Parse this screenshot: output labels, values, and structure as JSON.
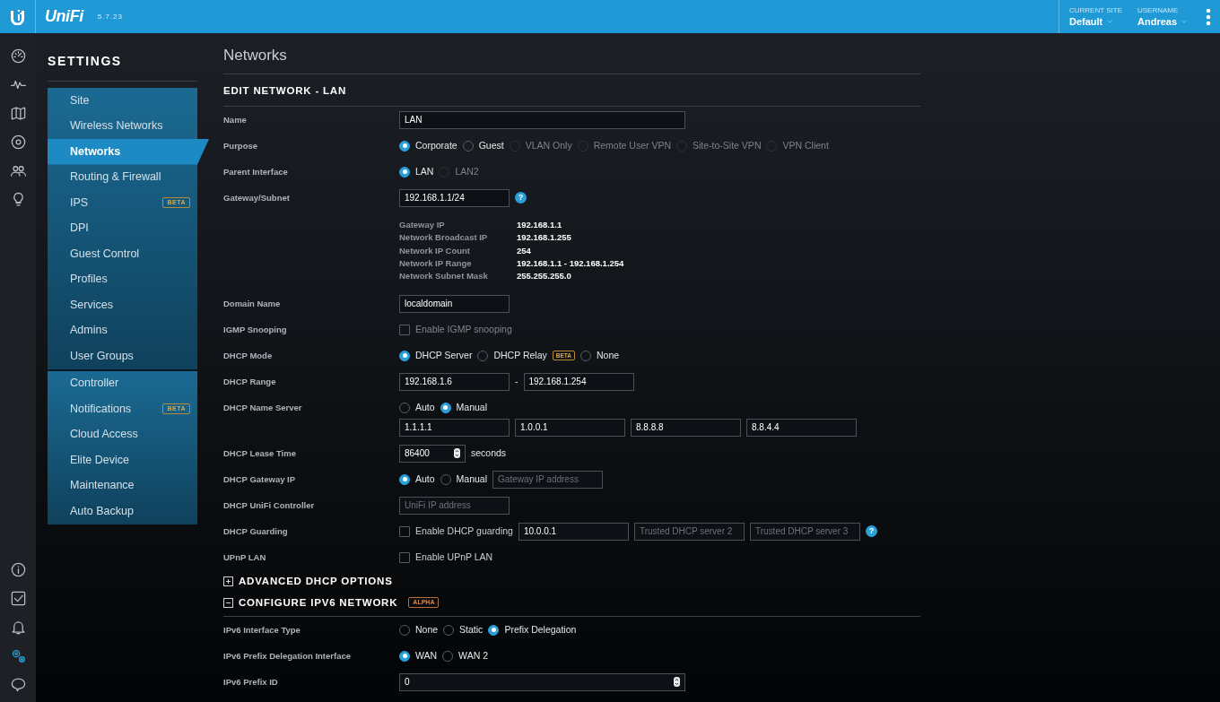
{
  "header": {
    "product": "UniFi",
    "version": "5.7.23",
    "site": {
      "label": "CURRENT SITE",
      "value": "Default"
    },
    "user": {
      "label": "USERNAME",
      "value": "Andreas"
    }
  },
  "rail": {
    "top": [
      {
        "kind": "dashboard",
        "selected": false
      },
      {
        "kind": "statistics",
        "selected": false
      },
      {
        "kind": "map",
        "selected": false
      },
      {
        "kind": "devices",
        "selected": false
      },
      {
        "kind": "clients",
        "selected": false
      },
      {
        "kind": "insights",
        "selected": false
      }
    ],
    "bottom": [
      {
        "kind": "info",
        "selected": false
      },
      {
        "kind": "tasks",
        "selected": false
      },
      {
        "kind": "alerts",
        "selected": false
      },
      {
        "kind": "settings",
        "selected": true
      },
      {
        "kind": "chat",
        "selected": false
      }
    ]
  },
  "settings": {
    "title": "SETTINGS",
    "groups": [
      [
        {
          "label": "Site",
          "selected": false
        },
        {
          "label": "Wireless Networks",
          "selected": false
        },
        {
          "label": "Networks",
          "selected": true
        },
        {
          "label": "Routing & Firewall",
          "selected": false
        },
        {
          "label": "IPS",
          "selected": false,
          "badge": "BETA"
        },
        {
          "label": "DPI",
          "selected": false
        },
        {
          "label": "Guest Control",
          "selected": false
        },
        {
          "label": "Profiles",
          "selected": false
        },
        {
          "label": "Services",
          "selected": false
        },
        {
          "label": "Admins",
          "selected": false
        },
        {
          "label": "User Groups",
          "selected": false
        }
      ],
      [
        {
          "label": "Controller",
          "selected": false
        },
        {
          "label": "Notifications",
          "selected": false,
          "badge": "BETA"
        },
        {
          "label": "Cloud Access",
          "selected": false
        },
        {
          "label": "Elite Device",
          "selected": false
        },
        {
          "label": "Maintenance",
          "selected": false
        },
        {
          "label": "Auto Backup",
          "selected": false
        }
      ]
    ]
  },
  "content": {
    "title": "Networks",
    "section_title": "EDIT NETWORK - LAN",
    "rows": [
      {
        "label": "Name",
        "lines": [
          [
            {
              "kind": "wide-input",
              "value": "LAN"
            }
          ]
        ]
      },
      {
        "label": "Purpose",
        "lines": [
          [
            {
              "kind": "radio",
              "label": "Corporate",
              "selected": true,
              "disabled": false
            },
            {
              "kind": "radio",
              "label": "Guest",
              "selected": false,
              "disabled": false
            },
            {
              "kind": "radio",
              "label": "VLAN Only",
              "selected": false,
              "disabled": true
            },
            {
              "kind": "radio",
              "label": "Remote User VPN",
              "selected": false,
              "disabled": true
            },
            {
              "kind": "radio",
              "label": "Site-to-Site VPN",
              "selected": false,
              "disabled": true
            },
            {
              "kind": "radio",
              "label": "VPN Client",
              "selected": false,
              "disabled": true
            }
          ]
        ]
      },
      {
        "label": "Parent Interface",
        "lines": [
          [
            {
              "kind": "radio",
              "label": "LAN",
              "selected": true,
              "disabled": false
            },
            {
              "kind": "radio",
              "label": "LAN2",
              "selected": false,
              "disabled": true
            }
          ]
        ]
      },
      {
        "label": "Gateway/Subnet",
        "lines": [
          [
            {
              "kind": "input",
              "value": "192.168.1.1/24"
            },
            {
              "kind": "help",
              "text": "?"
            }
          ]
        ]
      },
      {
        "kind": "info",
        "pairs": [
          {
            "label": "Gateway IP",
            "value": "192.168.1.1"
          },
          {
            "label": "Network Broadcast IP",
            "value": "192.168.1.255"
          },
          {
            "label": "Network IP Count",
            "value": "254"
          },
          {
            "label": "Network IP Range",
            "value": "192.168.1.1 - 192.168.1.254"
          },
          {
            "label": "Network Subnet Mask",
            "value": "255.255.255.0"
          }
        ]
      },
      {
        "label": "Domain Name",
        "lines": [
          [
            {
              "kind": "input",
              "value": "localdomain"
            }
          ]
        ]
      },
      {
        "label": "IGMP Snooping",
        "lines": [
          [
            {
              "kind": "checkbox",
              "label": "Enable IGMP snooping",
              "checked": false,
              "disabled": true
            }
          ]
        ]
      },
      {
        "label": "DHCP Mode",
        "lines": [
          [
            {
              "kind": "radio",
              "label": "DHCP Server",
              "selected": true,
              "disabled": false
            },
            {
              "kind": "radio",
              "label": "DHCP Relay",
              "selected": false,
              "disabled": false,
              "badge": "BETA"
            },
            {
              "kind": "radio",
              "label": "None",
              "selected": false,
              "disabled": false
            }
          ]
        ]
      },
      {
        "label": "DHCP Range",
        "lines": [
          [
            {
              "kind": "input",
              "value": "192.168.1.6"
            },
            {
              "kind": "text",
              "text": "-"
            },
            {
              "kind": "input",
              "value": "192.168.1.254"
            }
          ]
        ]
      },
      {
        "label": "DHCP Name Server",
        "lines": [
          [
            {
              "kind": "radio",
              "label": "Auto",
              "selected": false,
              "disabled": false
            },
            {
              "kind": "radio",
              "label": "Manual",
              "selected": true,
              "disabled": false
            }
          ],
          [
            {
              "kind": "input",
              "value": "1.1.1.1"
            },
            {
              "kind": "input",
              "value": "1.0.0.1"
            },
            {
              "kind": "input",
              "value": "8.8.8.8"
            },
            {
              "kind": "input",
              "value": "8.8.4.4"
            }
          ]
        ]
      },
      {
        "label": "DHCP Lease Time",
        "lines": [
          [
            {
              "kind": "number-input",
              "value": "86400"
            },
            {
              "kind": "text",
              "text": "seconds"
            }
          ]
        ]
      },
      {
        "label": "DHCP Gateway IP",
        "lines": [
          [
            {
              "kind": "radio",
              "label": "Auto",
              "selected": true,
              "disabled": false
            },
            {
              "kind": "radio",
              "label": "Manual",
              "selected": false,
              "disabled": false
            },
            {
              "kind": "input",
              "placeholder": "Gateway IP address"
            }
          ]
        ]
      },
      {
        "label": "DHCP UniFi Controller",
        "lines": [
          [
            {
              "kind": "input",
              "placeholder": "UniFi IP address"
            }
          ]
        ]
      },
      {
        "label": "DHCP Guarding",
        "lines": [
          [
            {
              "kind": "checkbox",
              "label": "Enable DHCP guarding",
              "checked": false,
              "disabled": false
            },
            {
              "kind": "input",
              "value": "10.0.0.1"
            },
            {
              "kind": "input",
              "placeholder": "Trusted DHCP server 2"
            },
            {
              "kind": "input",
              "placeholder": "Trusted DHCP server 3"
            },
            {
              "kind": "help",
              "text": "?"
            }
          ]
        ]
      },
      {
        "label": "UPnP LAN",
        "lines": [
          [
            {
              "kind": "checkbox",
              "label": "Enable UPnP LAN",
              "checked": false,
              "disabled": false
            }
          ]
        ]
      }
    ],
    "sections": [
      {
        "title": "ADVANCED DHCP OPTIONS",
        "expanded": false
      },
      {
        "title": "CONFIGURE IPV6 NETWORK",
        "expanded": true,
        "badge": "ALPHA",
        "rows": [
          {
            "label": "IPv6 Interface Type",
            "lines": [
              [
                {
                  "kind": "radio",
                  "label": "None",
                  "selected": false,
                  "disabled": false
                },
                {
                  "kind": "radio",
                  "label": "Static",
                  "selected": false,
                  "disabled": false
                },
                {
                  "kind": "radio",
                  "label": "Prefix Delegation",
                  "selected": true,
                  "disabled": false
                }
              ]
            ]
          },
          {
            "label": "IPv6 Prefix Delegation Interface",
            "lines": [
              [
                {
                  "kind": "radio",
                  "label": "WAN",
                  "selected": true,
                  "disabled": false
                },
                {
                  "kind": "radio",
                  "label": "WAN 2",
                  "selected": false,
                  "disabled": false
                }
              ]
            ]
          },
          {
            "label": "IPv6 Prefix ID",
            "lines": [
              [
                {
                  "kind": "wide-number-input",
                  "value": "0"
                }
              ]
            ]
          }
        ]
      }
    ]
  }
}
